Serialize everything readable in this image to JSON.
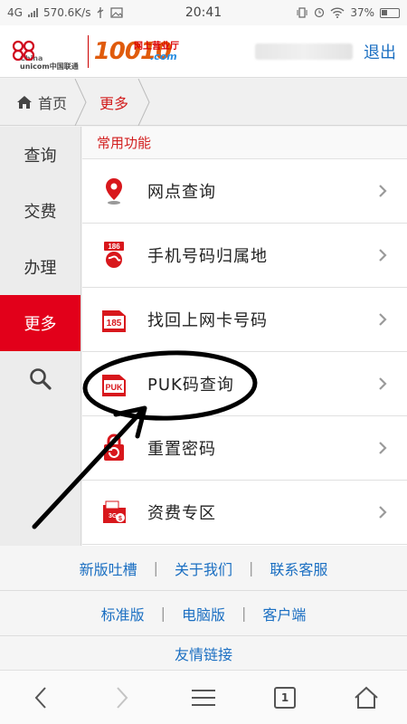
{
  "status_bar": {
    "network": "4G",
    "speed": "570.6K/s",
    "time": "20:41",
    "battery": "37%"
  },
  "header": {
    "logo_text_line1": "China",
    "logo_text_line2": "unicom中国联通",
    "brand_number": "10010",
    "brand_sub": "网上营业厅",
    "brand_domain": ".com",
    "logout_label": "退出"
  },
  "breadcrumb": {
    "home": "首页",
    "current": "更多"
  },
  "sidenav": {
    "items": [
      {
        "label": "查询"
      },
      {
        "label": "交费"
      },
      {
        "label": "办理"
      },
      {
        "label": "更多"
      }
    ],
    "search_icon": "search-icon"
  },
  "main": {
    "section_title": "常用功能",
    "items": [
      {
        "label": "网点查询",
        "icon": "map-pin-icon"
      },
      {
        "label": "手机号码归属地",
        "icon": "phone-location-icon",
        "icon_text": "186"
      },
      {
        "label": "找回上网卡号码",
        "icon": "sim-card-icon",
        "icon_text": "185"
      },
      {
        "label": "PUK码查询",
        "icon": "puk-card-icon",
        "icon_text": "PUK"
      },
      {
        "label": "重置密码",
        "icon": "lock-reset-icon"
      },
      {
        "label": "资费专区",
        "icon": "tariff-icon",
        "icon_text": "3G"
      }
    ]
  },
  "footer": {
    "row1": [
      "新版吐槽",
      "关于我们",
      "联系客服"
    ],
    "row2": [
      "标准版",
      "电脑版",
      "客户端"
    ],
    "row3": "友情链接",
    "separator": "|"
  },
  "browser_bar": {
    "tab_count": "1"
  },
  "colors": {
    "accent_red": "#e2001a",
    "link_blue": "#1b6fc2",
    "brand_orange": "#e05b0c"
  }
}
